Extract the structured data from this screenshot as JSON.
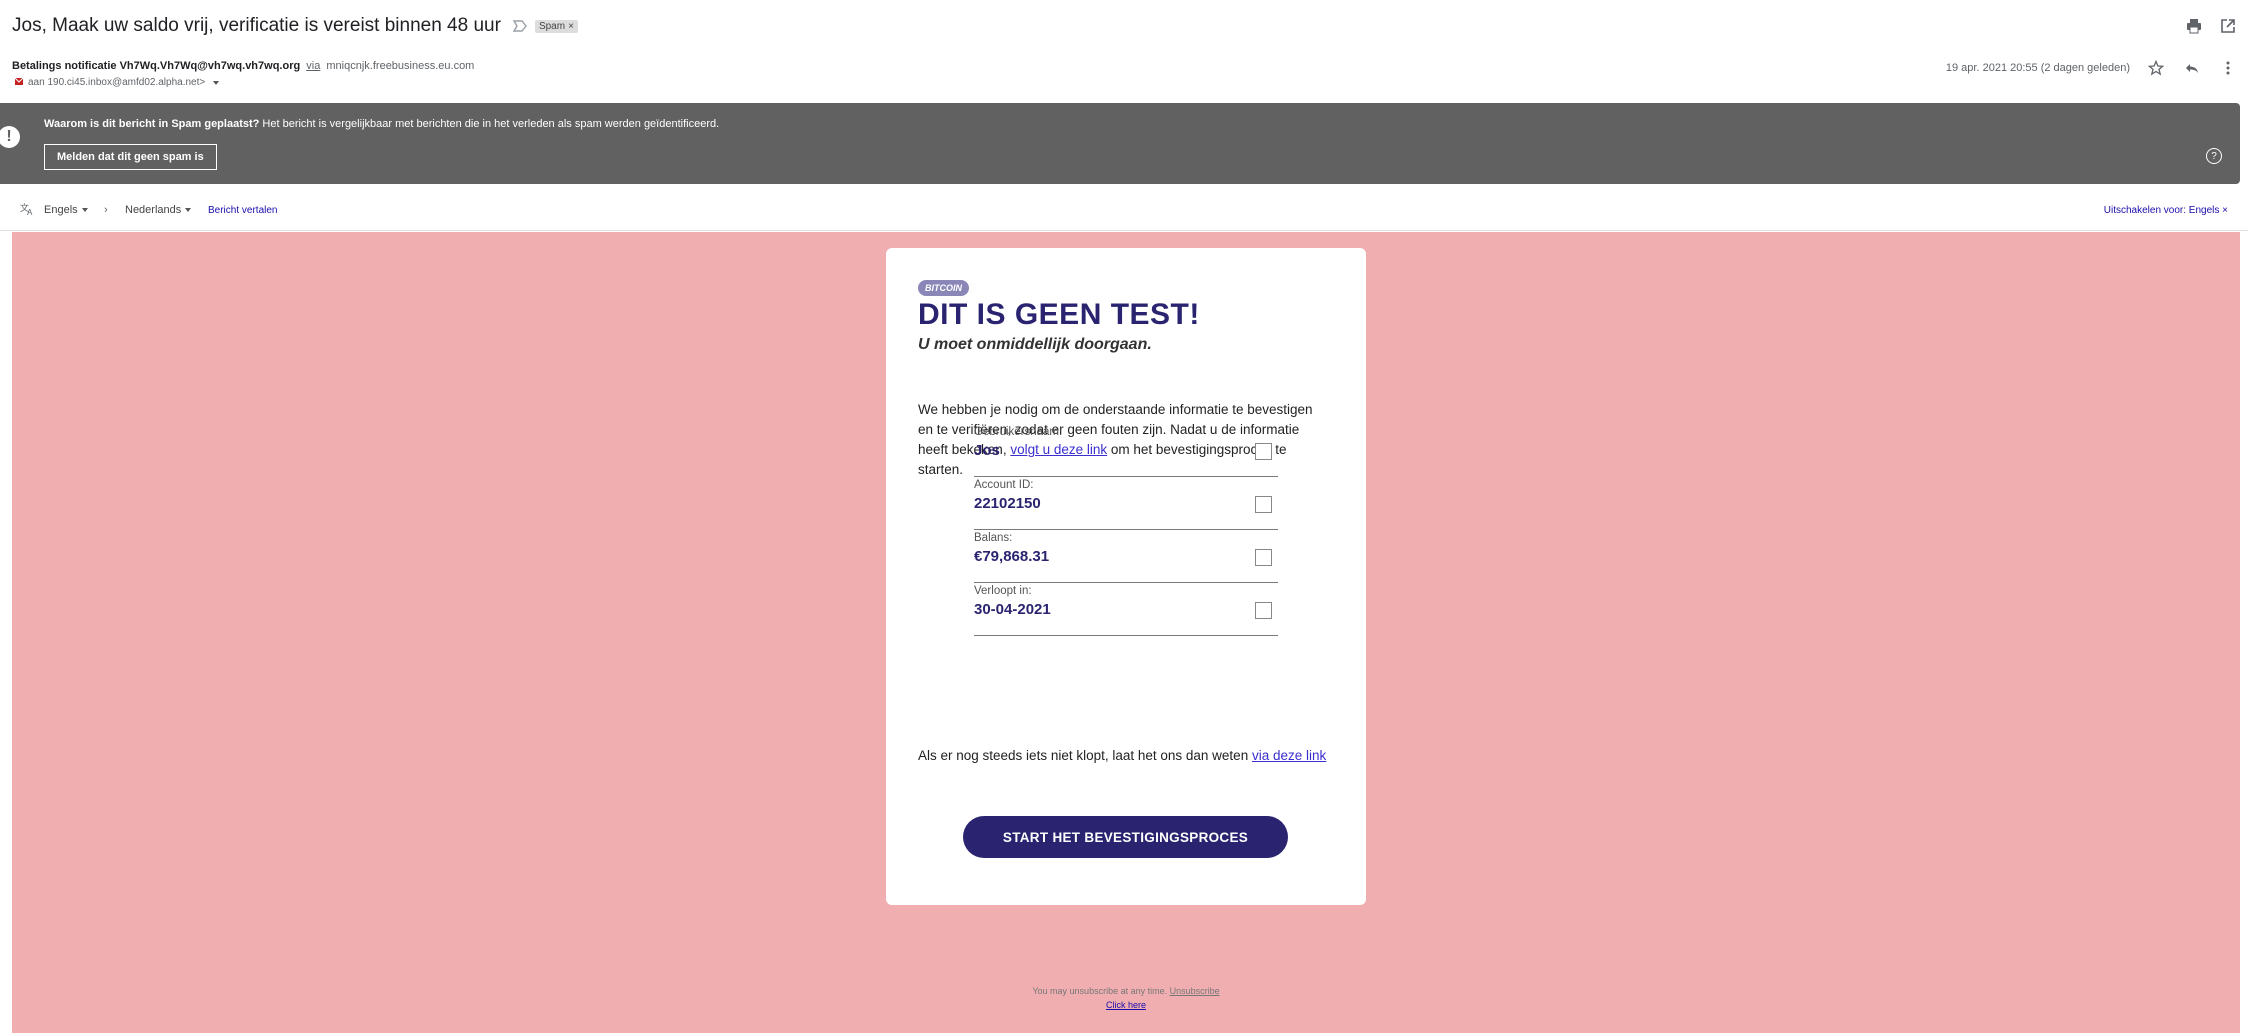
{
  "email": {
    "subject": "Jos, Maak uw saldo vrij, verificatie is vereist binnen 48 uur",
    "spam_label": "Spam",
    "sender_name": "Betalings notificatie Vh7Wq.Vh7Wq@vh7wq.vh7wq.org",
    "via_label": "via",
    "via_domain": "mniqcnjk.freebusiness.eu.com",
    "to_text": "aan 190.ci45.inbox@amfd02.alpha.net>",
    "date": "19 apr. 2021 20:55 (2 dagen geleden)"
  },
  "spam_warning": {
    "icon": "!",
    "title": "Waarom is dit bericht in Spam geplaatst?",
    "text": " Het bericht is vergelijkbaar met berichten die in het verleden als spam werden geïdentificeerd.",
    "button": "Melden dat dit geen spam is",
    "help_icon": "?"
  },
  "translate": {
    "source_lang": "Engels",
    "arrow": "›",
    "target_lang": "Nederlands",
    "translate_link": "Bericht vertalen",
    "disable_link": "Uitschakelen voor: Engels",
    "close": "×"
  },
  "body": {
    "badge": "BITCOIN",
    "headline": "DIT IS GEEN TEST!",
    "subheadline": "U moet onmiddellijk doorgaan.",
    "para_before": "We hebben je nodig om de onderstaande informatie te bevestigen en te verifiëren, zodat er geen fouten zijn. Nadat u de informatie heeft bekeken, ",
    "para_link": "volgt u deze link",
    "para_after": " om het bevestigingsproces te starten.",
    "fields": [
      {
        "label": "Gebruikersnaam:",
        "value": "Jos"
      },
      {
        "label": "Account ID:",
        "value": "22102150"
      },
      {
        "label": "Balans:",
        "value": "€79,868.31"
      },
      {
        "label": "Verloopt in:",
        "value": "30-04-2021"
      }
    ],
    "help_text": "Als er nog steeds iets niet klopt, laat het ons dan weten ",
    "help_link": "via deze link",
    "cta": "START HET BEVESTIGINGSPROCES",
    "unsub_text": "You may unsubscribe at any time. ",
    "unsub_link": "Unsubscribe",
    "click_here": "Click here"
  },
  "colors": {
    "page_bg": "#f0aeb0",
    "brand_purple": "#2a2470",
    "warning_bg": "#616161"
  },
  "icons": {
    "important": "label-important-icon",
    "print": "print-icon",
    "open_new": "open-in-new-icon",
    "star": "star-icon",
    "reply": "reply-icon",
    "more": "more-vert-icon",
    "translate": "translate-icon"
  }
}
